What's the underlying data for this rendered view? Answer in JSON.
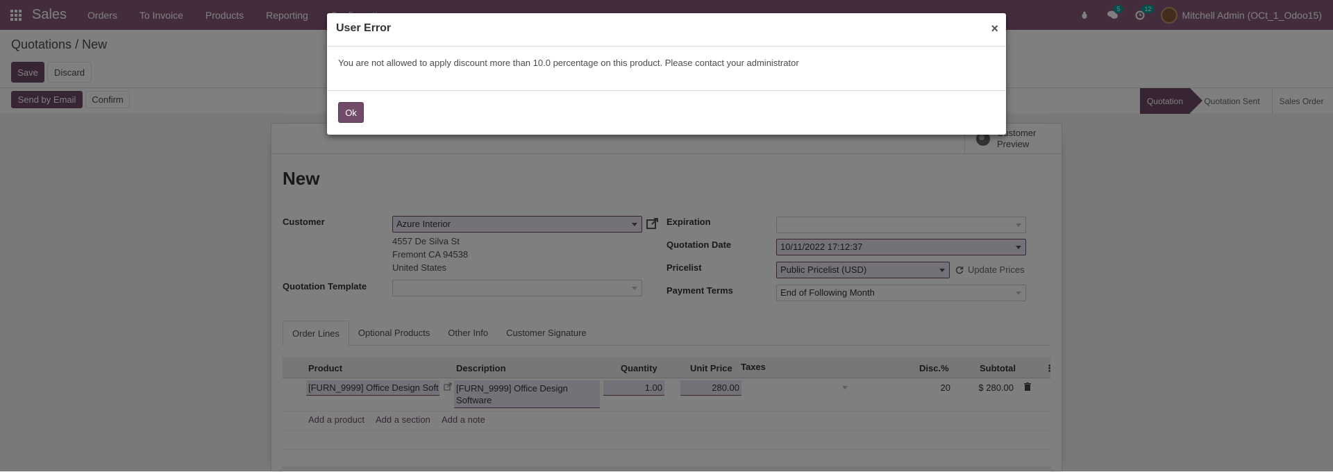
{
  "navbar": {
    "brand": "Sales",
    "menu": [
      "Orders",
      "To Invoice",
      "Products",
      "Reporting",
      "Configuration"
    ],
    "messages_count": "5",
    "activities_count": "12",
    "user": "Mitchell Admin (OCt_1_Odoo15)"
  },
  "breadcrumb": {
    "parent": "Quotations",
    "separator": " / ",
    "current": "New"
  },
  "buttons": {
    "save": "Save",
    "discard": "Discard",
    "send_email": "Send by Email",
    "confirm": "Confirm"
  },
  "status": {
    "stages": [
      "Quotation",
      "Quotation Sent",
      "Sales Order"
    ],
    "active": "Quotation"
  },
  "form": {
    "preview_line1": "Customer",
    "preview_line2": "Preview",
    "title": "New",
    "customer_label": "Customer",
    "customer_value": "Azure Interior",
    "address_line1": "4557 De Silva St",
    "address_line2": "Fremont CA 94538",
    "address_line3": "United States",
    "template_label": "Quotation Template",
    "template_value": "",
    "expiration_label": "Expiration",
    "expiration_value": "",
    "date_label": "Quotation Date",
    "date_value": "10/11/2022 17:12:37",
    "pricelist_label": "Pricelist",
    "pricelist_value": "Public Pricelist (USD)",
    "update_prices": "Update Prices",
    "terms_label": "Payment Terms",
    "terms_value": "End of Following Month"
  },
  "tabs": [
    "Order Lines",
    "Optional Products",
    "Other Info",
    "Customer Signature"
  ],
  "order_lines": {
    "columns": [
      "Product",
      "Description",
      "Quantity",
      "Unit Price",
      "Taxes",
      "Disc.%",
      "Subtotal"
    ],
    "rows": [
      {
        "product": "[FURN_9999] Office Design Soft",
        "description_line1": "[FURN_9999] Office Design",
        "description_line2": "Software",
        "quantity": "1.00",
        "unit_price": "280.00",
        "taxes": "",
        "discount": "20",
        "subtotal": "$ 280.00"
      }
    ],
    "add_product": "Add a product",
    "add_section": "Add a section",
    "add_note": "Add a note"
  },
  "dialog": {
    "title": "User Error",
    "close": "×",
    "message": "You are not allowed to apply discount more than 10.0 percentage on this product. Please contact your administrator",
    "ok": "Ok"
  },
  "colors": {
    "brand": "#875a7b",
    "primary": "#714b67",
    "badge": "#00a09d"
  },
  "icons": [
    "apps-grid-icon",
    "bug-icon",
    "chat-icon",
    "clock-icon",
    "external-link-icon",
    "globe-icon",
    "refresh-icon",
    "trash-icon",
    "kebab-icon",
    "close-icon"
  ]
}
